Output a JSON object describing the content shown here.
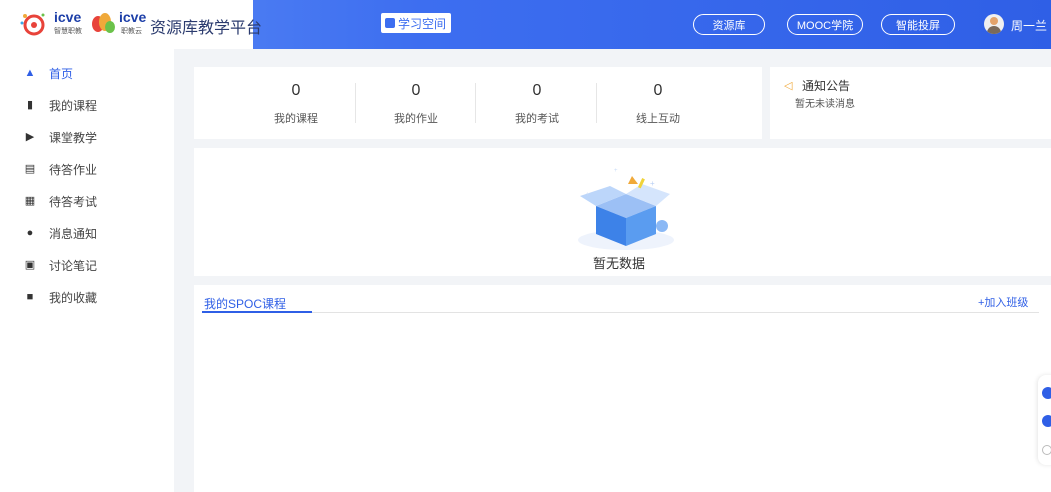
{
  "header": {
    "logo_text_1": "icve",
    "logo_sub_1": "智慧职教",
    "logo_text_2": "icve",
    "logo_sub_2": "职教云",
    "platform_title": "资源库教学平台",
    "study_space": "学习空间",
    "links": [
      "资源库",
      "MOOC学院",
      "智能投屏"
    ],
    "user_name": "周一兰"
  },
  "sidebar": {
    "items": [
      {
        "label": "首页",
        "icon": "home-icon"
      },
      {
        "label": "我的课程",
        "icon": "books-icon"
      },
      {
        "label": "课堂教学",
        "icon": "play-icon"
      },
      {
        "label": "待答作业",
        "icon": "homework-icon"
      },
      {
        "label": "待答考试",
        "icon": "exam-icon"
      },
      {
        "label": "消息通知",
        "icon": "message-icon"
      },
      {
        "label": "讨论笔记",
        "icon": "note-icon"
      },
      {
        "label": "我的收藏",
        "icon": "folder-icon"
      }
    ]
  },
  "stats": [
    {
      "value": "0",
      "label": "我的课程"
    },
    {
      "value": "0",
      "label": "我的作业"
    },
    {
      "value": "0",
      "label": "我的考试"
    },
    {
      "value": "0",
      "label": "线上互动"
    }
  ],
  "notice": {
    "title": "通知公告",
    "message": "暂无未读消息"
  },
  "empty": {
    "text": "暂无数据"
  },
  "spoc": {
    "tab_label": "我的SPOC课程",
    "add_label": "+加入班级"
  },
  "colors": {
    "brand": "#2f5fe6",
    "header_start": "#5d8df5",
    "notice_icon": "#f0a93a"
  }
}
